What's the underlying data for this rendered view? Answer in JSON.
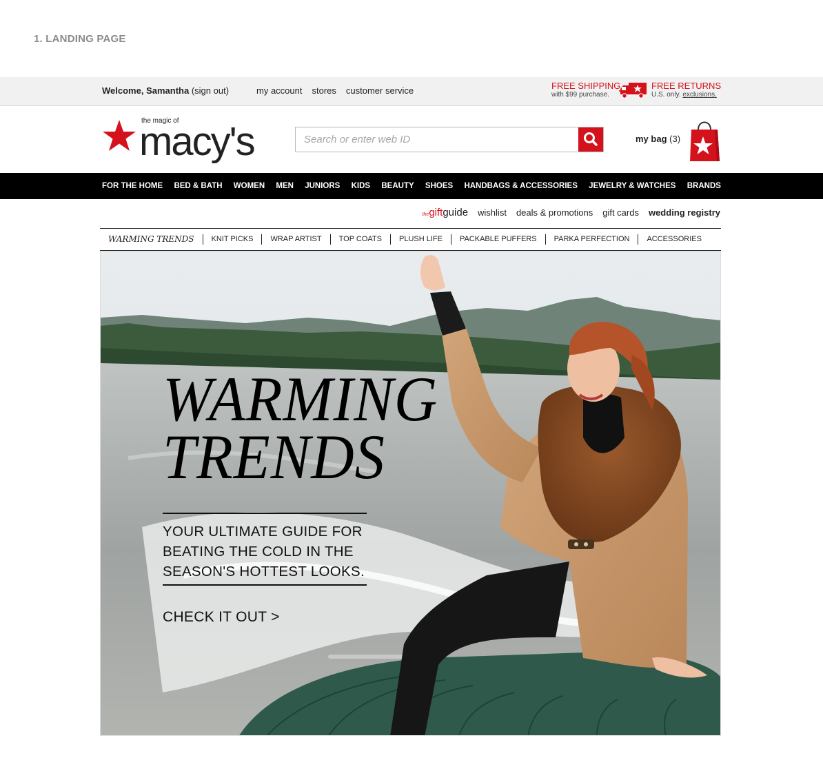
{
  "page_label": "1. LANDING PAGE",
  "utility": {
    "welcome_prefix": "Welcome, Samantha",
    "sign_out": "(sign out)",
    "links": [
      "my account",
      "stores",
      "customer service"
    ],
    "free_shipping": "FREE SHIPPING",
    "free_shipping_note": "with $99 purchase.",
    "free_returns": "FREE RETURNS",
    "free_returns_note": "U.S. only.",
    "exclusions": "exclusions."
  },
  "header": {
    "logo_tagline": "the magic of",
    "logo_word": "macy's",
    "search_placeholder": "Search or enter web ID",
    "bag_label": "my bag",
    "bag_count": "(3)"
  },
  "main_nav": [
    "FOR THE HOME",
    "BED & BATH",
    "WOMEN",
    "MEN",
    "JUNIORS",
    "KIDS",
    "BEAUTY",
    "SHOES",
    "HANDBAGS & ACCESSORIES",
    "JEWELRY & WATCHES",
    "BRANDS"
  ],
  "secondary": {
    "gift_the": "the",
    "gift_word": "gift",
    "guide_word": "guide",
    "links": [
      "wishlist",
      "deals & promotions",
      "gift cards"
    ],
    "wedding": "wedding registry"
  },
  "sub_nav": [
    "WARMING TRENDS",
    "KNIT PICKS",
    "WRAP ARTIST",
    "TOP COATS",
    "PLUSH LIFE",
    "PACKABLE PUFFERS",
    "PARKA PERFECTION",
    "ACCESSORIES"
  ],
  "hero": {
    "title_line1": "WARMING",
    "title_line2": "TRENDS",
    "subtitle": "YOUR ULTIMATE GUIDE FOR BEATING THE COLD IN THE SEASON'S HOTTEST LOOKS.",
    "cta": "CHECK IT OUT >"
  },
  "colors": {
    "brand_red": "#d4121c",
    "nav_black": "#000000",
    "util_bg": "#f1f1f1"
  }
}
